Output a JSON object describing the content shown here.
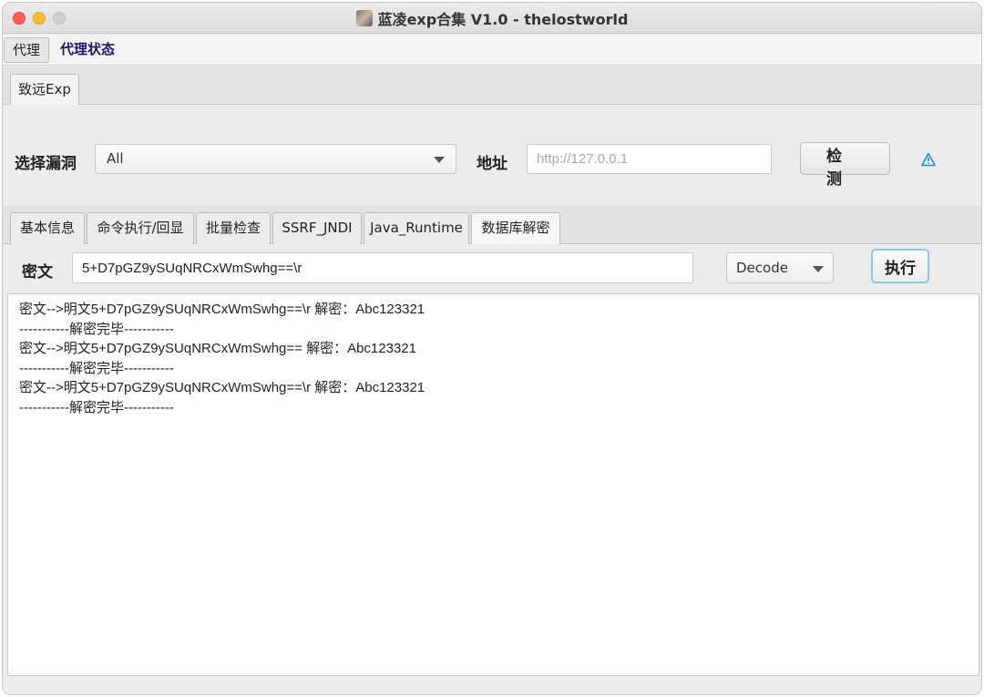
{
  "window": {
    "title": "蓝凌exp合集 V1.0 - thelostworld"
  },
  "menu": {
    "proxy": "代理",
    "proxy_status": "代理状态"
  },
  "top_tab": {
    "label": "致远Exp"
  },
  "form": {
    "vuln_label": "选择漏洞",
    "vuln_selected": "All",
    "addr_label": "地址",
    "addr_placeholder": "http://127.0.0.1",
    "detect_button": "检测"
  },
  "sub_tabs": [
    {
      "label": "基本信息"
    },
    {
      "label": "命令执行/回显"
    },
    {
      "label": "批量检查"
    },
    {
      "label": "SSRF_JNDI"
    },
    {
      "label": "Java_Runtime"
    },
    {
      "label": "数据库解密",
      "active": true
    }
  ],
  "decrypt": {
    "cipher_label": "密文",
    "cipher_value": "5+D7pGZ9ySUqNRCxWmSwhg==\\r",
    "mode_selected": "Decode",
    "exec_button": "执行"
  },
  "output_lines": [
    "密文-->明文5+D7pGZ9ySUqNRCxWmSwhg==\\r 解密：Abc123321",
    "-----------解密完毕-----------",
    "密文-->明文5+D7pGZ9ySUqNRCxWmSwhg== 解密：Abc123321",
    "-----------解密完毕-----------",
    "密文-->明文5+D7pGZ9ySUqNRCxWmSwhg==\\r 解密：Abc123321",
    "-----------解密完毕-----------"
  ],
  "icons": {
    "app": "app-icon",
    "warning": "warning-icon",
    "dropdown": "chevron-down-icon"
  },
  "colors": {
    "accent_focus": "#8ec5ef",
    "proxy_status_text": "#1d1475",
    "warning_icon": "#1a8fd8"
  }
}
